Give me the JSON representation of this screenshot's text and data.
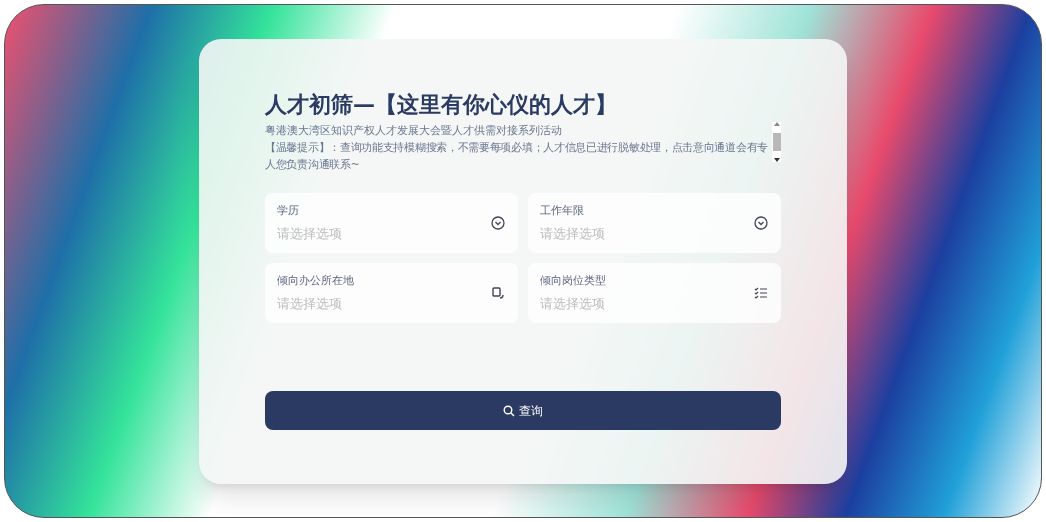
{
  "header": {
    "title": "人才初筛—【这里有你心仪的人才】",
    "subtitle": "粤港澳大湾区知识产权人才发展大会暨人才供需对接系列活动",
    "notice": "【温馨提示】：查询功能支持模糊搜索，不需要每项必填；人才信息已进行脱敏处理，点击意向通道会有专人您负责沟通联系~"
  },
  "filters": [
    {
      "label": "学历",
      "placeholder": "请选择选项",
      "kind": "dropdown"
    },
    {
      "label": "工作年限",
      "placeholder": "请选择选项",
      "kind": "dropdown"
    },
    {
      "label": "倾向办公所在地",
      "placeholder": "请选择选项",
      "kind": "location"
    },
    {
      "label": "倾向岗位类型",
      "placeholder": "请选择选项",
      "kind": "checklist"
    }
  ],
  "search_button": {
    "label": "查询"
  }
}
